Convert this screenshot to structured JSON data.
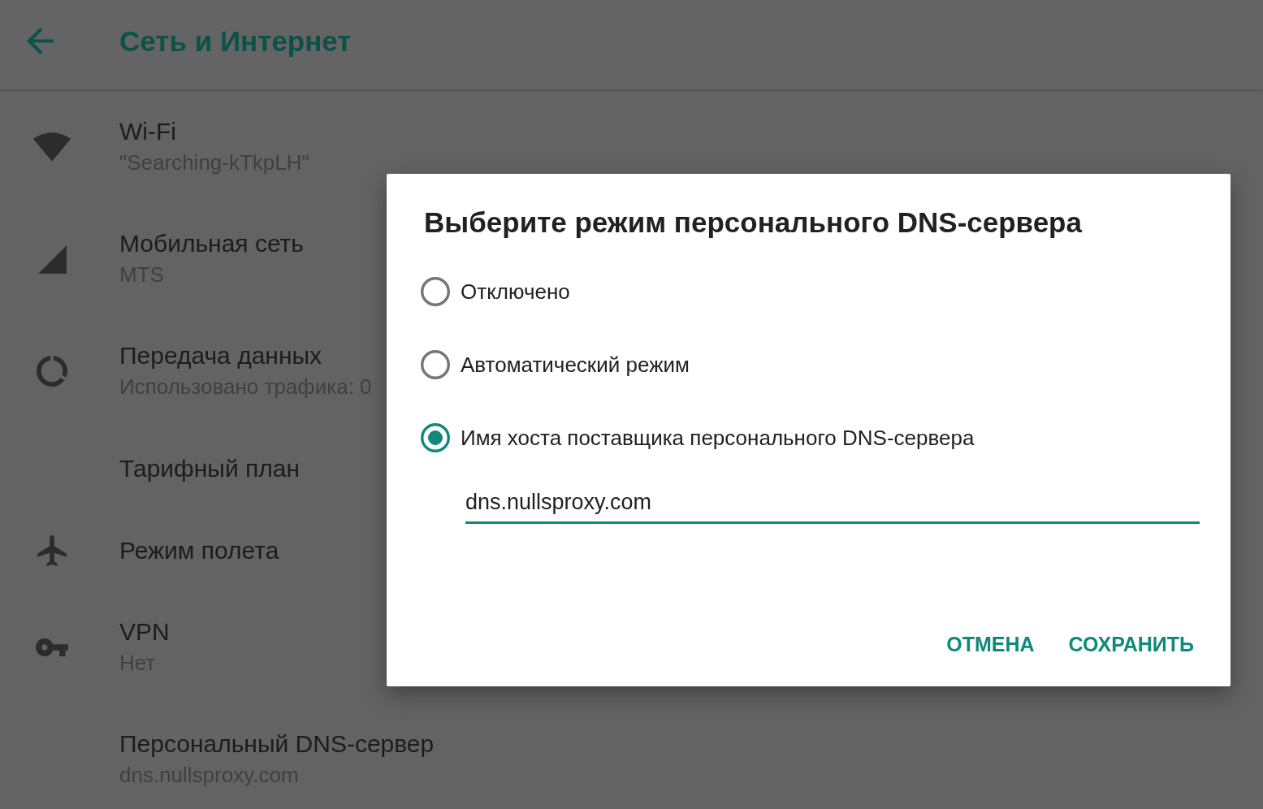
{
  "app_bar": {
    "title": "Сеть и Интернет"
  },
  "settings": [
    {
      "kind": "wifi",
      "title": "Wi-Fi",
      "summary": "\"Searching-kTkpLH\""
    },
    {
      "kind": "mobile",
      "title": "Мобильная сеть",
      "summary": "MTS"
    },
    {
      "kind": "usage",
      "title": "Передача данных",
      "summary": "Использовано трафика: 0"
    },
    {
      "kind": "plain",
      "title": "Тарифный план"
    },
    {
      "kind": "airplane",
      "title": "Режим полета"
    },
    {
      "kind": "vpn",
      "title": "VPN",
      "summary": "Нет"
    },
    {
      "kind": "plain",
      "title": "Персональный DNS-сервер",
      "summary": "dns.nullsproxy.com"
    }
  ],
  "dialog": {
    "title": "Выберите режим персонального DNS-сервера",
    "options": [
      {
        "label": "Отключено",
        "selected": false
      },
      {
        "label": "Автоматический режим",
        "selected": false
      },
      {
        "label": "Имя хоста поставщика персонального DNS-сервера",
        "selected": true
      }
    ],
    "hostname_field": {
      "value": "dns.nullsproxy.com",
      "focused": true
    },
    "buttons": [
      "ОТМЕНА",
      "СОХРАНИТЬ"
    ]
  }
}
